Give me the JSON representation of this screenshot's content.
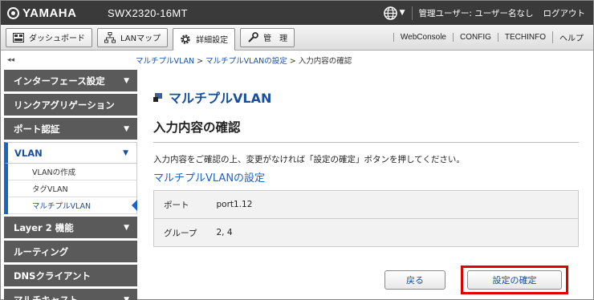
{
  "header": {
    "brand": "YAMAHA",
    "model": "SWX2320-16MT",
    "user_text": "管理ユーザー: ユーザー名なし",
    "logout": "ログアウト",
    "lang_caret": "▼"
  },
  "tabs": [
    {
      "label": "ダッシュボード",
      "icon": "dashboard-icon"
    },
    {
      "label": "LANマップ",
      "icon": "lan-map-icon"
    },
    {
      "label": "詳細設定",
      "icon": "gear-icon"
    },
    {
      "label": "管　理",
      "icon": "wrench-icon"
    }
  ],
  "links": [
    "WebConsole",
    "CONFIG",
    "TECHINFO",
    "ヘルプ"
  ],
  "collapse": "◂◂",
  "breadcrumb": {
    "items": [
      "マルチプルVLAN",
      "マルチプルVLANの設定",
      "入力内容の確認"
    ],
    "sep": " > "
  },
  "sidebar": {
    "items": [
      {
        "label": "インターフェース設定",
        "arrow": "▼"
      },
      {
        "label": "リンクアグリゲーション",
        "arrow": ""
      },
      {
        "label": "ポート認証",
        "arrow": "▼"
      },
      {
        "label": "VLAN",
        "arrow": "▼"
      },
      {
        "label": "Layer 2 機能",
        "arrow": "▼"
      },
      {
        "label": "ルーティング",
        "arrow": ""
      },
      {
        "label": "DNSクライアント",
        "arrow": ""
      },
      {
        "label": "マルチキャスト",
        "arrow": "▼"
      }
    ],
    "vlan_sub": [
      "VLANの作成",
      "タグVLAN",
      "マルチプルVLAN"
    ]
  },
  "main": {
    "page_title": "マルチプルVLAN",
    "section_title": "入力内容の確認",
    "description": "入力内容をご確認の上、変更がなければ「設定の確定」ボタンを押してください。",
    "settings_title": "マルチプルVLANの設定",
    "rows": [
      {
        "key": "ポート",
        "value": "port1.12"
      },
      {
        "key": "グループ",
        "value": "2, 4"
      }
    ],
    "back_label": "戻る",
    "confirm_label": "設定の確定"
  },
  "colors": {
    "accent": "#1a4fa0",
    "highlight": "#e00000",
    "header": "#3a3a3a"
  }
}
